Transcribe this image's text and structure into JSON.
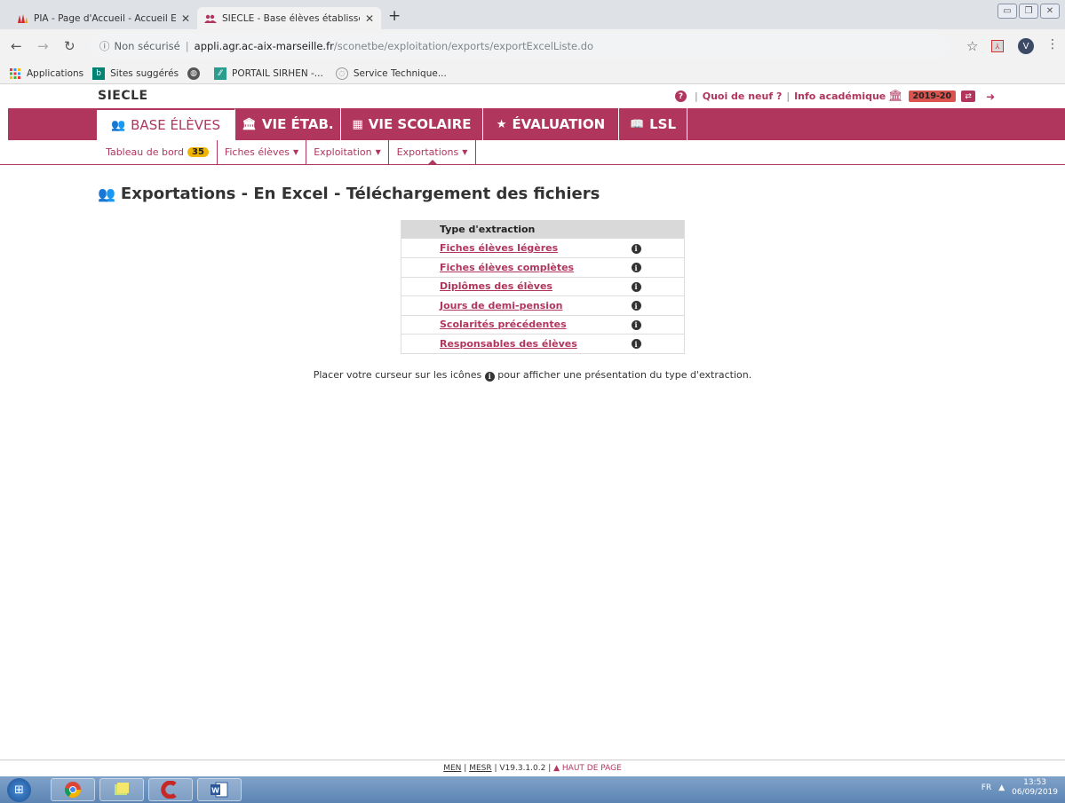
{
  "browser": {
    "tabs": [
      {
        "title": "PIA - Page d'Accueil - Accueil Ep",
        "active": false
      },
      {
        "title": "SIECLE - Base élèves établisseme",
        "active": true
      }
    ],
    "url_security": "Non sécurisé",
    "url_host": "appli.agr.ac-aix-marseille.fr",
    "url_path": "/sconetbe/exploitation/exports/exportExcelListe.do",
    "avatar_letter": "V",
    "bookmarks": [
      {
        "label": "Applications",
        "icon": "apps-grid-icon"
      },
      {
        "label": "Sites suggérés",
        "icon": "bing-icon"
      },
      {
        "label": "",
        "icon": "globe-icon"
      },
      {
        "label": "PORTAIL SIRHEN -...",
        "icon": "sirhen-icon"
      },
      {
        "label": "Service Technique...",
        "icon": "page-icon"
      }
    ]
  },
  "app": {
    "brand": "SIECLE",
    "top_links": [
      "Quoi de neuf ?",
      "Info académique"
    ],
    "year": "2019-20"
  },
  "main_nav": [
    {
      "label": "BASE ÉLÈVES",
      "icon": "users-icon",
      "active": true
    },
    {
      "label": "VIE ÉTAB.",
      "icon": "institution-icon",
      "active": false
    },
    {
      "label": "VIE SCOLAIRE",
      "icon": "calendar-icon",
      "active": false
    },
    {
      "label": "ÉVALUATION",
      "icon": "star-icon",
      "active": false
    },
    {
      "label": "LSL",
      "icon": "book-icon",
      "active": false
    }
  ],
  "sub_nav": [
    {
      "label": "Tableau de bord",
      "badge": "35"
    },
    {
      "label": "Fiches élèves",
      "dropdown": true
    },
    {
      "label": "Exploitation",
      "dropdown": true
    },
    {
      "label": "Exportations",
      "dropdown": true,
      "current": true
    }
  ],
  "page": {
    "title": "Exportations - En Excel - Téléchargement des fichiers",
    "table_header": "Type d'extraction",
    "extractions": [
      "Fiches élèves légères",
      "Fiches élèves complètes",
      "Diplômes des élèves",
      "Jours de demi-pension",
      "Scolarités précédentes",
      "Responsables des élèves"
    ],
    "hint_before": "Placer votre curseur sur les icônes",
    "hint_after": "pour afficher une présentation du type d'extraction."
  },
  "footer": {
    "men": "MEN",
    "mesr": "MESR",
    "version": "V19.3.1.0.2",
    "top_link": "HAUT DE PAGE"
  },
  "taskbar": {
    "lang": "FR",
    "time": "13:53",
    "date": "06/09/2019"
  },
  "colors": {
    "brand": "#b0365d",
    "badge": "#f0b400",
    "year_badge": "#d9534f"
  }
}
